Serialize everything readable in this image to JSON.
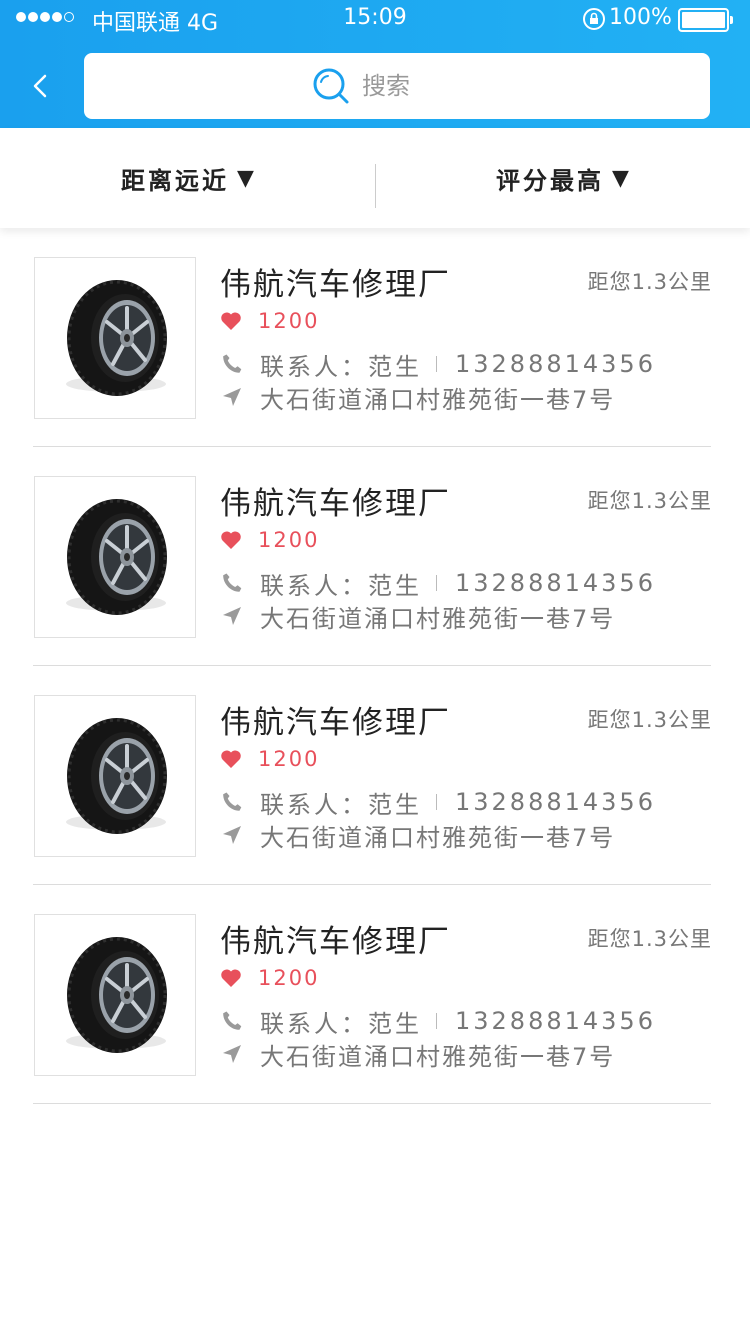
{
  "status_bar": {
    "carrier": "中国联通 4G",
    "time": "15:09",
    "battery": "100%"
  },
  "search": {
    "placeholder": "搜索",
    "value": ""
  },
  "filters": [
    {
      "label": "距离远近",
      "arrow": "▼"
    },
    {
      "label": "评分最高",
      "arrow": "▼"
    }
  ],
  "colors": {
    "header_blue": "#1aa0ee",
    "rating_red": "#e8505b"
  },
  "shops": [
    {
      "name": "伟航汽车修理厂",
      "distance": "距您1.3公里",
      "rating": "1200",
      "contact_label": "联系人：",
      "contact_name": "范生",
      "phone": "13288814356",
      "address": "大石街道涌口村雅苑街一巷7号",
      "image_icon": "tire-image"
    },
    {
      "name": "伟航汽车修理厂",
      "distance": "距您1.3公里",
      "rating": "1200",
      "contact_label": "联系人：",
      "contact_name": "范生",
      "phone": "13288814356",
      "address": "大石街道涌口村雅苑街一巷7号",
      "image_icon": "tire-image"
    },
    {
      "name": "伟航汽车修理厂",
      "distance": "距您1.3公里",
      "rating": "1200",
      "contact_label": "联系人：",
      "contact_name": "范生",
      "phone": "13288814356",
      "address": "大石街道涌口村雅苑街一巷7号",
      "image_icon": "tire-image"
    },
    {
      "name": "伟航汽车修理厂",
      "distance": "距您1.3公里",
      "rating": "1200",
      "contact_label": "联系人：",
      "contact_name": "范生",
      "phone": "13288814356",
      "address": "大石街道涌口村雅苑街一巷7号",
      "image_icon": "tire-image"
    }
  ]
}
